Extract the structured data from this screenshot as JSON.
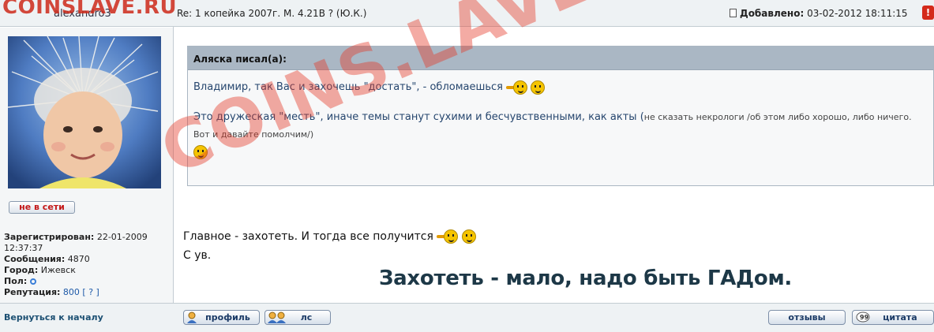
{
  "header": {
    "author": "alexandro3",
    "subject": "Re: 1 копейка 2007г. М. 4.21В ? (Ю.К.)",
    "added_label": "Добавлено:",
    "added_value": "03-02-2012 18:11:15",
    "report_icon": "!"
  },
  "user": {
    "status_button": "не в сети",
    "registered_label": "Зарегистрирован:",
    "registered_value": "22-01-2009 12:37:37",
    "messages_label": "Сообщения:",
    "messages_value": "4870",
    "city_label": "Город:",
    "city_value": "Ижевск",
    "gender_label": "Пол:",
    "gender_icon": "male-icon",
    "reputation_label": "Репутация:",
    "reputation_value": "800",
    "reputation_link": "[ ? ]"
  },
  "quote": {
    "header": "Аляска писал(а):",
    "line1": "Владимир, так Вас и захочешь \"достать\", - обломаешься",
    "line2": "Это дружеская \"месть\", иначе темы станут сухими и бесчувственными, как акты",
    "line2_small_open": "(",
    "line2_small": "не сказать некрологи /об этом либо хорошо, либо ничего. Вот и давайте помолчим/)"
  },
  "post": {
    "line1": "Главное - захотеть. И тогда все получится",
    "line2": "С ув.",
    "signature": "Захотеть - мало, надо быть ГАДом."
  },
  "footer": {
    "back_link": "Вернуться к началу",
    "profile_button": "профиль",
    "pm_button": "лс",
    "reviews_button": "отзывы",
    "quote_button": "цитата"
  },
  "watermark": {
    "top": "COINSLAVE.RU",
    "diagonal": "COINS.LAVE.RU"
  },
  "colors": {
    "watermark": "#e53a28",
    "offline": "#c41818",
    "quote_header_bg": "#aab7c4",
    "link": "#1b4f72"
  }
}
